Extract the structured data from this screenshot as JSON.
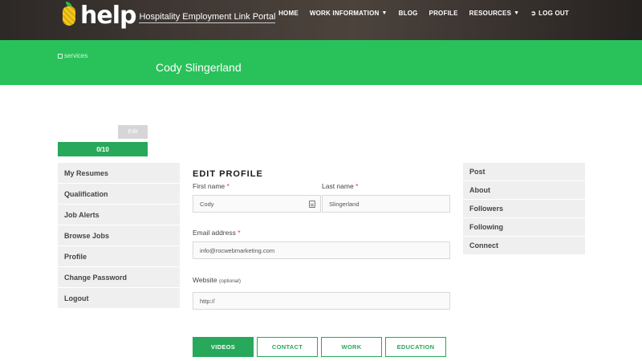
{
  "header": {
    "logo_word": "help",
    "logo_tagline": "Hospitality Employment Link Portal",
    "nav": [
      {
        "label": "HOME",
        "dropdown": false
      },
      {
        "label": "WORK INFORMATION",
        "dropdown": true
      },
      {
        "label": "BLOG",
        "dropdown": false
      },
      {
        "label": "PROFILE",
        "dropdown": false
      },
      {
        "label": "RESOURCES",
        "dropdown": true
      },
      {
        "label": "LOG OUT",
        "dropdown": false,
        "icon": "logout-icon"
      }
    ]
  },
  "banner": {
    "image_alt": "services",
    "name": "Cody Slingerland",
    "color": "#29c25a"
  },
  "profile": {
    "edit_label": "Edit",
    "progress_text": "0/10",
    "progress_fraction": 0.0
  },
  "left_menu": [
    "My Resumes",
    "Qualification",
    "Job Alerts",
    "Browse Jobs",
    "Profile",
    "Change Password",
    "Logout"
  ],
  "right_menu": [
    "Post",
    "About",
    "Followers",
    "Following",
    "Connect"
  ],
  "form": {
    "title": "EDIT PROFILE",
    "first_name_label": "First name",
    "first_name_value": "Cody",
    "last_name_label": "Last name",
    "last_name_value": "Slingerland",
    "email_label": "Email address",
    "email_value": "info@rocwebmarketing.com",
    "website_label": "Website",
    "website_optional": "(optional)",
    "website_value": "http://",
    "required_mark": "*"
  },
  "tabs": [
    {
      "label": "VIDEOS",
      "active": true
    },
    {
      "label": "CONTACT",
      "active": false
    },
    {
      "label": "WORK",
      "active": false
    },
    {
      "label": "EDUCATION",
      "active": false
    }
  ],
  "colors": {
    "accent": "#27a85a",
    "banner": "#29c25a",
    "required": "#e03a3a"
  }
}
